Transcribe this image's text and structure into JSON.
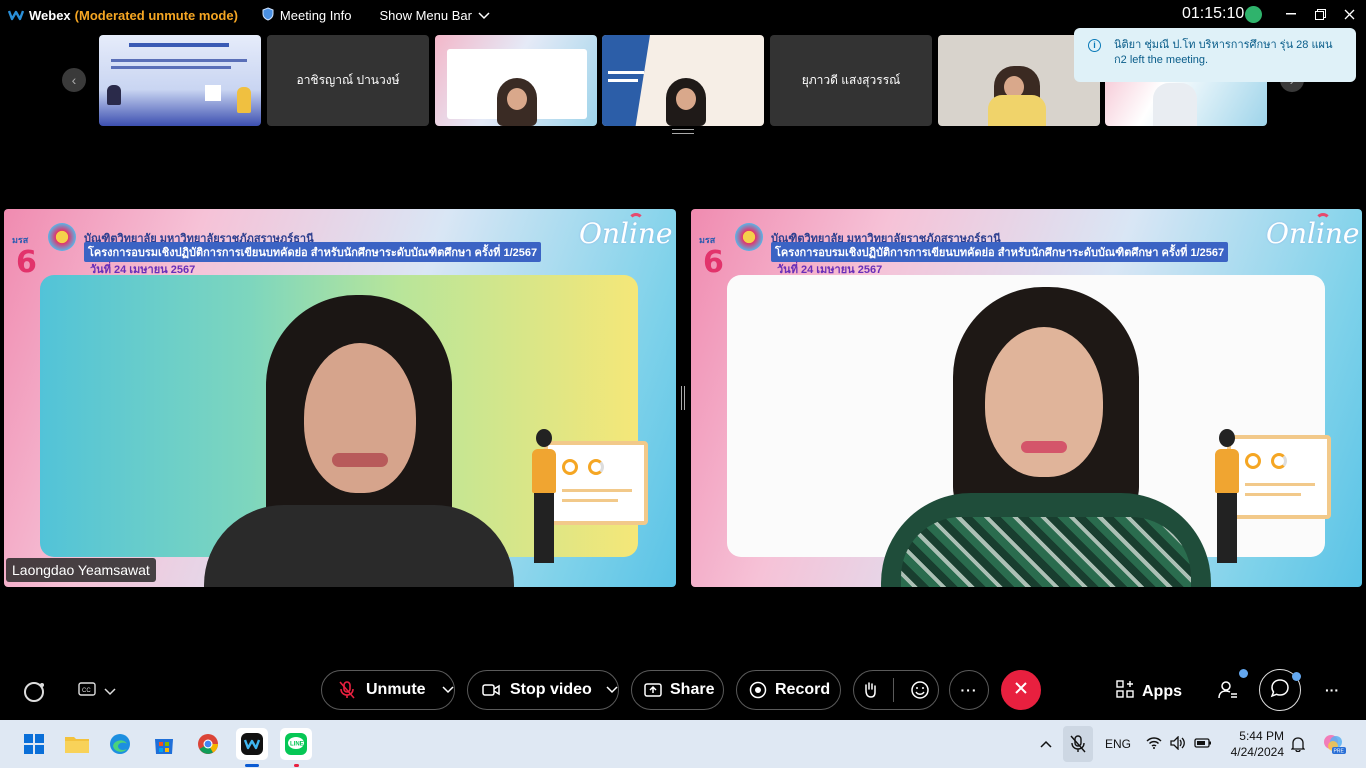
{
  "titlebar": {
    "app_name": "Webex",
    "mode": "(Moderated unmute mode)",
    "meeting_info": "Meeting Info",
    "show_menu_bar": "Show Menu Bar",
    "clock": "01:15:10"
  },
  "thumbnails": [
    {
      "type": "slide",
      "label": ""
    },
    {
      "type": "name",
      "label": "อาชิรญาณ์ ปานวงษ์"
    },
    {
      "type": "video",
      "label": ""
    },
    {
      "type": "video",
      "label": ""
    },
    {
      "type": "name",
      "label": "ยุภาวดี แสงสุวรรณ์"
    },
    {
      "type": "video",
      "label": ""
    },
    {
      "type": "video",
      "label": ""
    }
  ],
  "toast": {
    "text": "นิติยา ชุ่มณี ป.โท บริหารการศึกษา รุ่น 28 แผน ก2 left the meeting."
  },
  "tiles": [
    {
      "header_line1": "บัณฑิตวิทยาลัย มหาวิทยาลัยราชภัฏสุราษฎร์ธานี",
      "header_line2": "โครงการอบรมเชิงปฏิบัติการการเขียนบทคัดย่อ สำหรับนักศึกษาระดับบัณฑิตศึกษา ครั้งที่ 1/2567",
      "header_line3": "วันที่ 24 เมษายน 2567",
      "online_badge": "Online",
      "logo_caption": "มรส",
      "logo_number": "6",
      "participant": "Laongdao Yeamsawat"
    },
    {
      "header_line1": "บัณฑิตวิทยาลัย มหาวิทยาลัยราชภัฏสุราษฎร์ธานี",
      "header_line2": "โครงการอบรมเชิงปฏิบัติการการเขียนบทคัดย่อ สำหรับนักศึกษาระดับบัณฑิตศึกษา ครั้งที่ 1/2567",
      "header_line3": "วันที่ 24 เมษายน 2567",
      "online_badge": "Online",
      "logo_caption": "มรส",
      "logo_number": "6",
      "participant": ""
    }
  ],
  "controls": {
    "unmute": "Unmute",
    "stop_video": "Stop video",
    "share": "Share",
    "record": "Record",
    "apps": "Apps",
    "more": "···"
  },
  "taskbar": {
    "language": "ENG",
    "time": "5:44 PM",
    "date": "4/24/2024",
    "colors": {
      "accent": "#0a5bd3",
      "end_call": "#e8203f"
    }
  }
}
